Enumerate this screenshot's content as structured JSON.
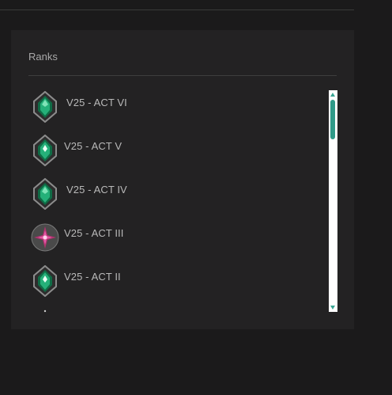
{
  "panel": {
    "title": "Ranks",
    "items": [
      {
        "label": "V25 - ACT VI",
        "icon": "emerald-rank-icon"
      },
      {
        "label": "V25 - ACT V",
        "icon": "emerald-rank-icon"
      },
      {
        "label": "V25 - ACT IV",
        "icon": "emerald-rank-icon"
      },
      {
        "label": "V25 - ACT III",
        "icon": "magenta-star-rank-icon"
      },
      {
        "label": "V25 - ACT II",
        "icon": "emerald-rank-icon"
      }
    ]
  },
  "colors": {
    "background": "#1b1a1b",
    "panel": "#232223",
    "accent": "#2f9a88",
    "emerald": "#1f8f5c",
    "magenta": "#c83a8c"
  }
}
